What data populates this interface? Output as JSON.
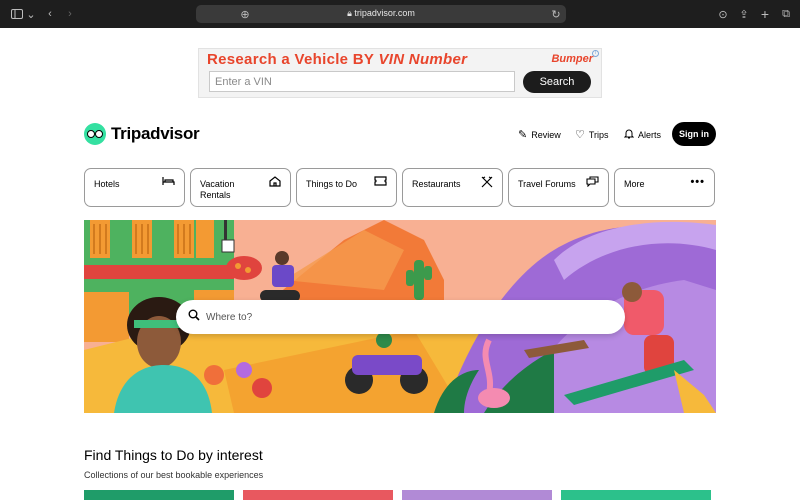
{
  "browser": {
    "url": "tripadvisor.com",
    "icons": [
      "sidebar-icon",
      "chevron-down-icon",
      "back-icon",
      "forward-icon",
      "privacy-shield-icon",
      "grammarly-icon",
      "site-settings-icon",
      "lock-icon",
      "reload-icon",
      "download-icon",
      "share-icon",
      "new-tab-icon",
      "tabs-overview-icon"
    ]
  },
  "ad": {
    "headline_prefix": "Research a Vehicle BY",
    "headline_emphasis": "VIN Number",
    "brand": "Bumper",
    "input_placeholder": "Enter a VIN",
    "button_label": "Search"
  },
  "header": {
    "logo_text": "Tripadvisor",
    "nav": [
      {
        "label": "Review",
        "icon": "pencil-icon"
      },
      {
        "label": "Trips",
        "icon": "heart-icon"
      },
      {
        "label": "Alerts",
        "icon": "bell-icon"
      }
    ],
    "signin_label": "Sign in"
  },
  "categories": [
    {
      "label": "Hotels",
      "icon": "bed-icon"
    },
    {
      "label": "Vacation Rentals",
      "icon": "house-icon"
    },
    {
      "label": "Things to Do",
      "icon": "ticket-icon"
    },
    {
      "label": "Restaurants",
      "icon": "utensils-icon"
    },
    {
      "label": "Travel Forums",
      "icon": "chat-icon"
    },
    {
      "label": "More",
      "icon": "more-dots-icon"
    }
  ],
  "hero": {
    "search_placeholder": "Where to?"
  },
  "section": {
    "title": "Find Things to Do by interest",
    "subtitle": "Collections of our best bookable experiences"
  },
  "colors": {
    "brand_green": "#34e0a1",
    "ad_red": "#e8452c",
    "card_colors": [
      "#1f9c69",
      "#e8585f",
      "#b18ad6",
      "#2cc18b"
    ]
  }
}
